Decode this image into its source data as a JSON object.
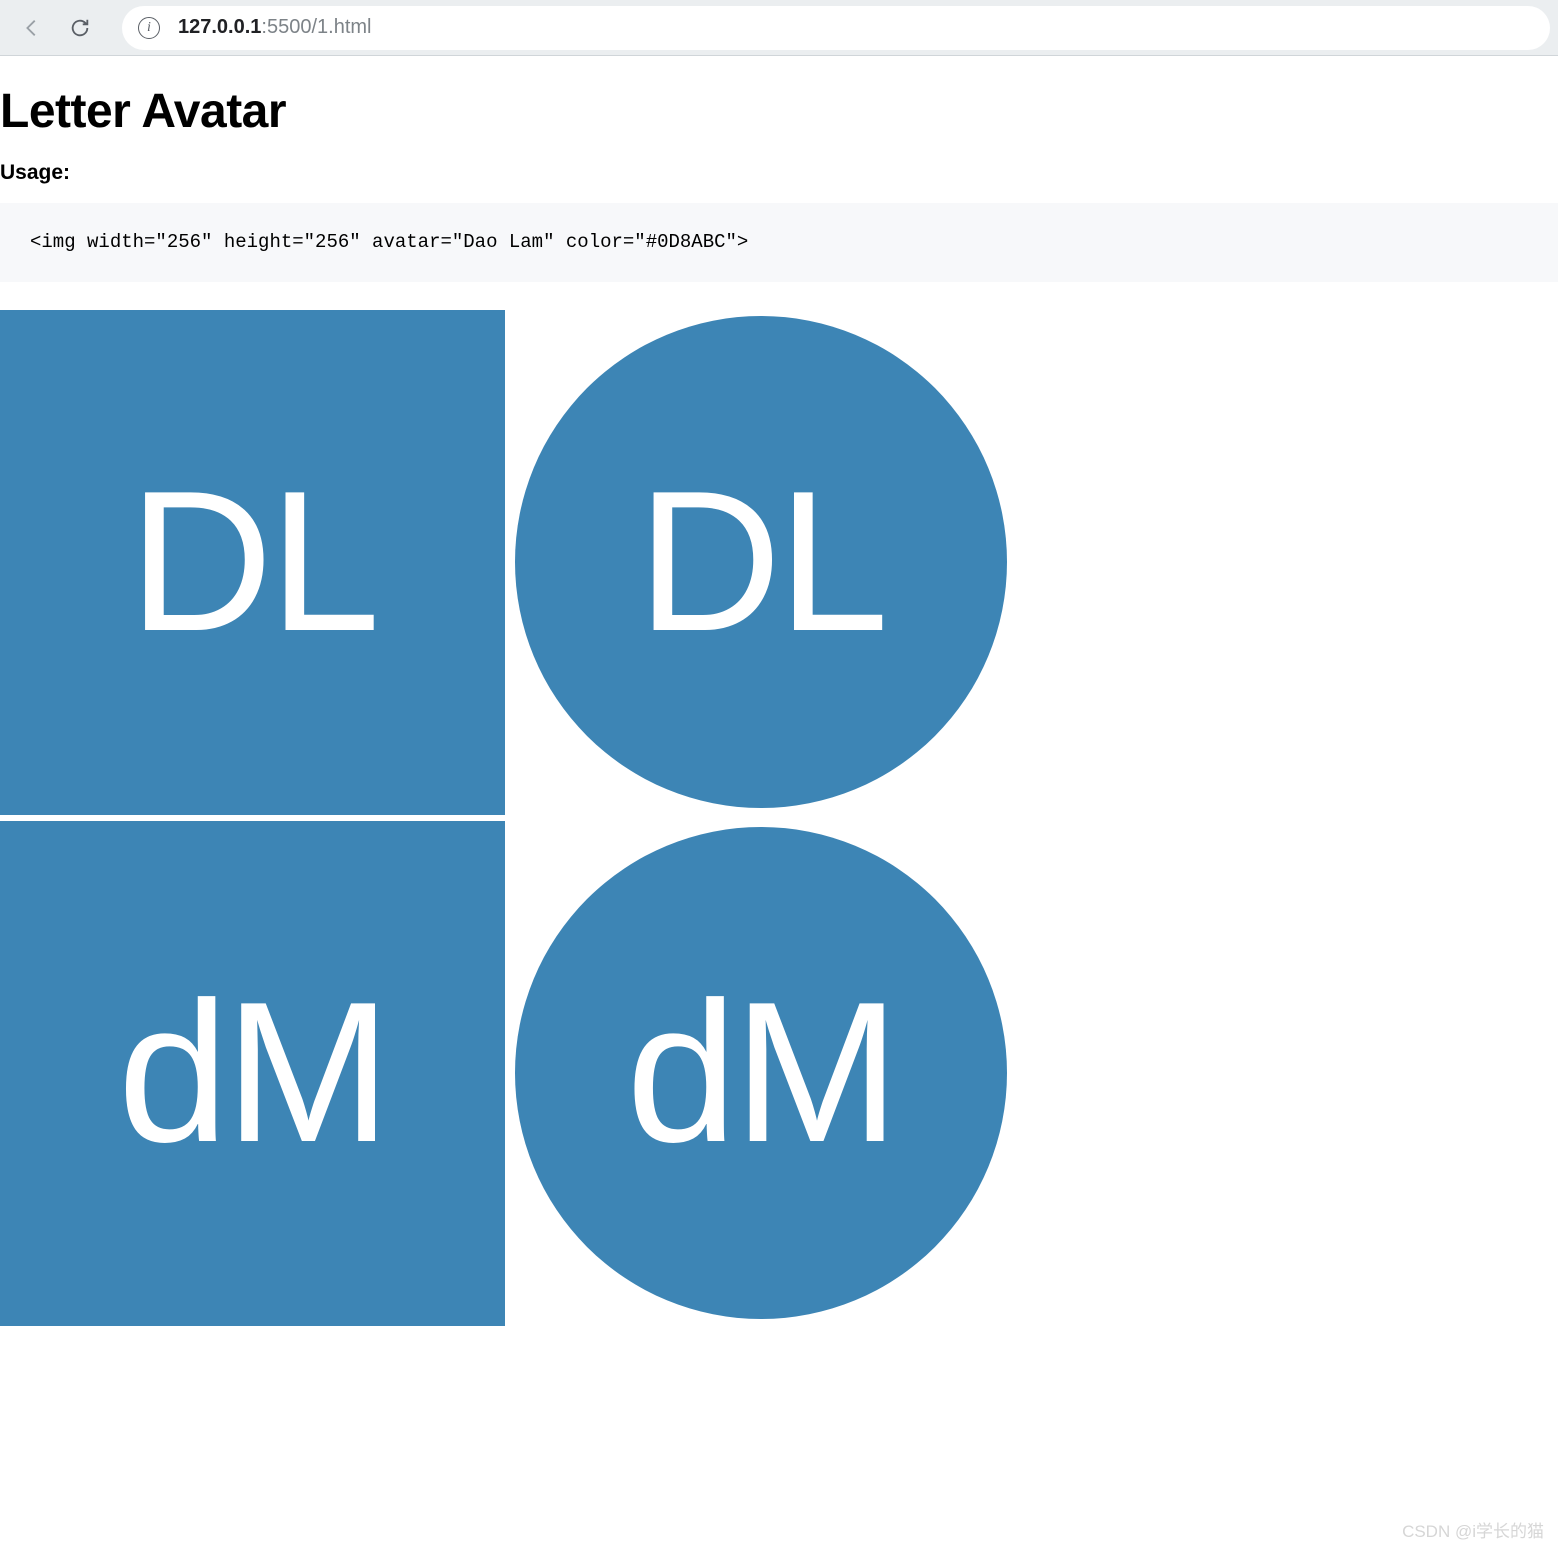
{
  "browser": {
    "url_host": "127.0.0.1",
    "url_path": ":5500/1.html",
    "info_glyph": "i"
  },
  "page": {
    "title": "Letter Avatar",
    "usage_label": "Usage:",
    "code_sample": "<img width=\"256\" height=\"256\" avatar=\"Dao Lam\" color=\"#0D8ABC\">"
  },
  "avatars": [
    {
      "initials": "DL",
      "shape": "square",
      "bg": "#3d85b5"
    },
    {
      "initials": "DL",
      "shape": "round",
      "bg": "#3d85b5"
    },
    {
      "initials": "dM",
      "shape": "square",
      "bg": "#3d85b5"
    },
    {
      "initials": "dM",
      "shape": "round",
      "bg": "#3d85b5"
    }
  ],
  "watermark": "CSDN @i学长的猫"
}
